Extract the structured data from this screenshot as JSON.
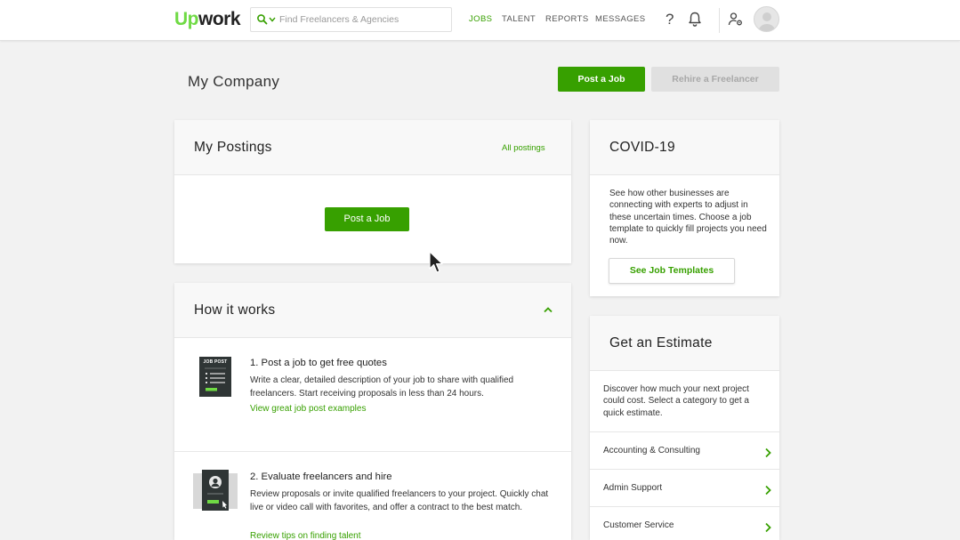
{
  "header": {
    "logo_up": "Up",
    "logo_work": "work",
    "search_placeholder": "Find Freelancers & Agencies",
    "nav": [
      "JOBS",
      "TALENT",
      "REPORTS",
      "MESSAGES"
    ],
    "help_glyph": "?",
    "icons": [
      "search-icon",
      "chevron-down-icon",
      "help-icon",
      "bell-icon",
      "people-settings-icon",
      "avatar"
    ],
    "accent_color": "#37a000",
    "brand_color": "#6fda44"
  },
  "page": {
    "title": "My Company",
    "post_job_label": "Post a Job",
    "rehire_label": "Rehire a Freelancer"
  },
  "postings": {
    "title": "My Postings",
    "all_link": "All postings",
    "post_button": "Post a Job"
  },
  "how": {
    "title": "How it works",
    "steps": [
      {
        "title": "1. Post a job to get free quotes",
        "desc": "Write a clear, detailed description of your job to share with qualified freelancers. Start receiving proposals in less than 24 hours.",
        "link": "View great job post examples",
        "icon_text": "JOB POST"
      },
      {
        "title": "2. Evaluate freelancers and hire",
        "desc": "Review proposals or invite qualified freelancers to your project. Quickly chat live or video call with favorites, and offer a contract to the best match.",
        "link": "Review tips on finding talent"
      }
    ]
  },
  "covid": {
    "title": "COVID-19",
    "text": "See how other businesses are connecting with experts to adjust in these uncertain times. Choose a job template to quickly fill projects you need now.",
    "button": "See Job Templates"
  },
  "estimate": {
    "title": "Get an Estimate",
    "text": "Discover how much your next project could cost. Select a category to get a quick estimate.",
    "categories": [
      "Accounting & Consulting",
      "Admin Support",
      "Customer Service"
    ]
  }
}
